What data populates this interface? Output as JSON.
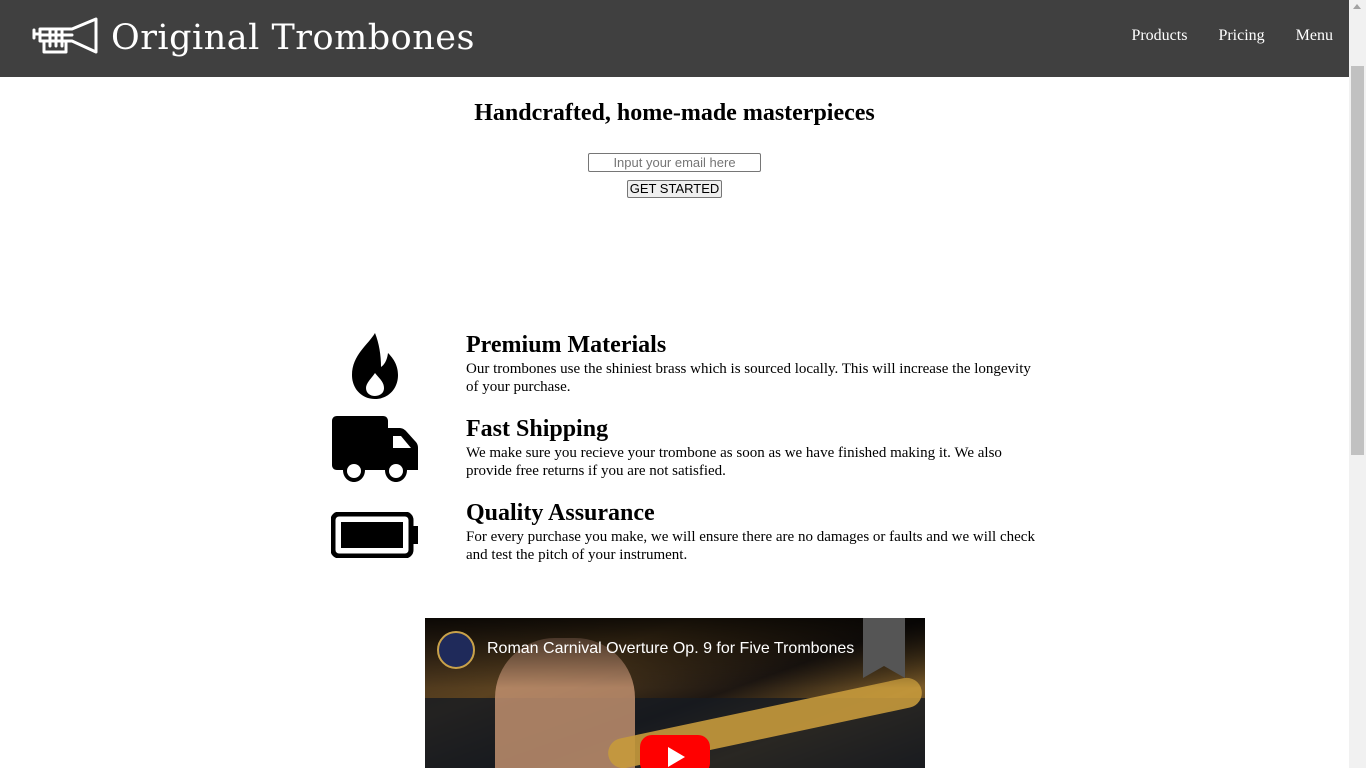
{
  "header": {
    "logo_alt": "trumpet-logo",
    "brand": "Original Trombones",
    "nav": [
      "Products",
      "Pricing",
      "Menu"
    ]
  },
  "hero": {
    "title": "Handcrafted, home-made masterpieces",
    "email_placeholder": "Input your email here",
    "cta_label": "GET STARTED"
  },
  "features": [
    {
      "icon": "fire-icon",
      "title": "Premium Materials",
      "description": "Our trombones use the shiniest brass which is sourced locally. This will increase the longevity of your purchase."
    },
    {
      "icon": "truck-icon",
      "title": "Fast Shipping",
      "description": "We make sure you recieve your trombone as soon as we have finished making it. We also provide free returns if you are not satisfied."
    },
    {
      "icon": "battery-full-icon",
      "title": "Quality Assurance",
      "description": "For every purchase you make, we will ensure there are no damages or faults and we will check and test the pitch of your instrument."
    }
  ],
  "video": {
    "title": "Roman Carnival Overture Op. 9 for Five Trombones",
    "play_icon": "youtube-play-icon"
  },
  "colors": {
    "header_bg": "#404040",
    "header_text": "#ffffff",
    "youtube_red": "#ff0000"
  }
}
